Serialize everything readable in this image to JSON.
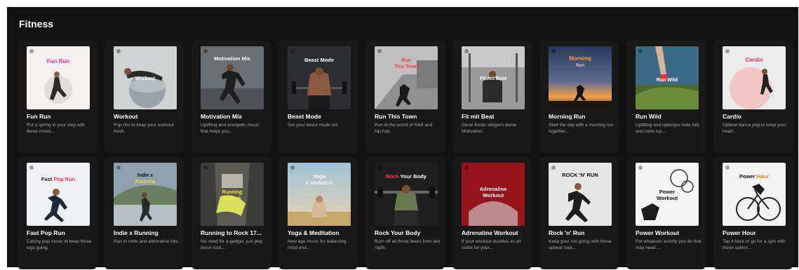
{
  "section": {
    "title": "Fitness"
  },
  "cards": [
    {
      "title": "Fun Run",
      "description": "Put a spring in your step with these mood...",
      "art_text": "Fun Run",
      "art_accent": "#ff2d8c"
    },
    {
      "title": "Workout",
      "description": "Pop hits to keep your workout fresh.",
      "art_text": "Workout",
      "art_accent": "#ffffff"
    },
    {
      "title": "Motivation Mix",
      "description": "Uplifting and energetic music that helps you...",
      "art_text": "Motivation Mix",
      "art_accent": "#ffffff"
    },
    {
      "title": "Beast Mode",
      "description": "Get your beast mode on!",
      "art_text": "Beast Mode",
      "art_accent": "#ffffff"
    },
    {
      "title": "Run This Town",
      "description": "Run to the world of R&B and hip-hop.",
      "art_text": "Run This Town",
      "art_accent": "#ff3a3a"
    },
    {
      "title": "Fit mit Beat",
      "description": "Diese Beats steigern deine Motivation.",
      "art_text": "Fit mit Beat",
      "art_accent": "#ffffff"
    },
    {
      "title": "Morning Run",
      "description": "Start the day with a morning run together...",
      "art_text": "Morning Run",
      "art_accent": "#ff9a2e"
    },
    {
      "title": "Run Wild",
      "description": "Uplifting and uptempo indie folk and roots roc...",
      "art_text": "Run Wild",
      "art_accent": "#ffffff"
    },
    {
      "title": "Cardio",
      "description": "Upbeat dance pop to keep your heart...",
      "art_text": "Cardio",
      "art_accent": "#ff2d55"
    },
    {
      "title": "Fast Pop Run",
      "description": "Catchy pop music to keep those legs going.",
      "art_text": "Fast Pop Run",
      "art_accent": "#ff2d55"
    },
    {
      "title": "Indie x Running",
      "description": "Run to indie and alternative hits.",
      "art_text": "Indie x Running",
      "art_accent": "#ffd21f"
    },
    {
      "title": "Running to Rock 17...",
      "description": "No need for a gadget, just play these rock...",
      "art_text": "Running to Rock",
      "art_accent": "#ffe03a"
    },
    {
      "title": "Yoga & Meditation",
      "description": "New age music for balancing mind and...",
      "art_text": "Yoga & Meditation",
      "art_accent": "#ffffff"
    },
    {
      "title": "Rock Your Body",
      "description": "Burn off all those beers from last night.",
      "art_text": "Rock Your Body",
      "art_accent": "#ff3a3a"
    },
    {
      "title": "Adrenaline Workout",
      "description": "If your workout doubles as an outlet for your...",
      "art_text": "Adrenaline Workout",
      "art_accent": "#ffffff"
    },
    {
      "title": "Rock 'n' Run",
      "description": "Keep your run going with these upbeat rock...",
      "art_text": "ROCK 'N' RUN",
      "art_accent": "#111111"
    },
    {
      "title": "Power Workout",
      "description": "For whatever activity you do that may need ...",
      "art_text": "Power Workout",
      "art_accent": "#111111"
    },
    {
      "title": "Power Hour",
      "description": "Tap it back or go for a spin with these uptem...",
      "art_text": "Power Hour",
      "art_accent": "#ff7a00"
    }
  ]
}
